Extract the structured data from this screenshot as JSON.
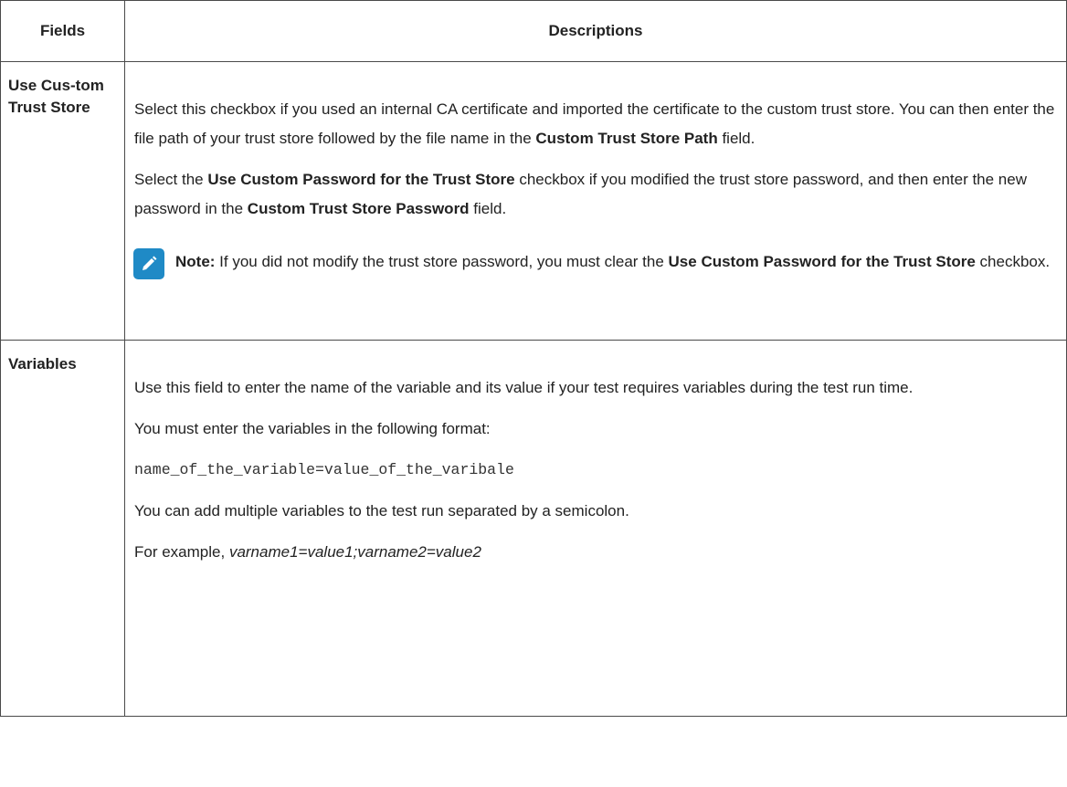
{
  "table": {
    "header": {
      "fields": "Fields",
      "descriptions": "Descriptions"
    },
    "rows": [
      {
        "field": "Use Cus-tom Trust Store",
        "paragraphs": [
          {
            "p1_a": "Select this checkbox if you used an internal CA certificate and imported the certificate to the custom trust store. You can then enter the file path of your trust store followed by the file name in the ",
            "p1_b": "Custom Trust Store Path",
            "p1_c": " field."
          },
          {
            "p2_a": "Select the ",
            "p2_b": "Use Custom Password for the Trust Store",
            "p2_c": " checkbox if you modified the trust store password, and then enter the new password in the ",
            "p2_d": "Custom Trust Store Password",
            "p2_e": " field."
          }
        ],
        "note": {
          "label": "Note:",
          "text_a": " If you did not modify the trust store password, you must clear the ",
          "text_b": "Use Custom Password for the Trust Store",
          "text_c": " checkbox.",
          "icon": "pencil-icon",
          "icon_color": "#1f8ac6"
        }
      },
      {
        "field": "Variables",
        "p1": "Use this field to enter the name of the variable and its value if your test requires variables during the test run time.",
        "p2": "You must enter the variables in the following format:",
        "code": "name_of_the_variable=value_of_the_varibale",
        "p3": "You can add multiple variables to the test run separated by a semicolon.",
        "p4_a": "For example, ",
        "p4_b": "varname1=value1;varname2=value2"
      }
    ]
  }
}
